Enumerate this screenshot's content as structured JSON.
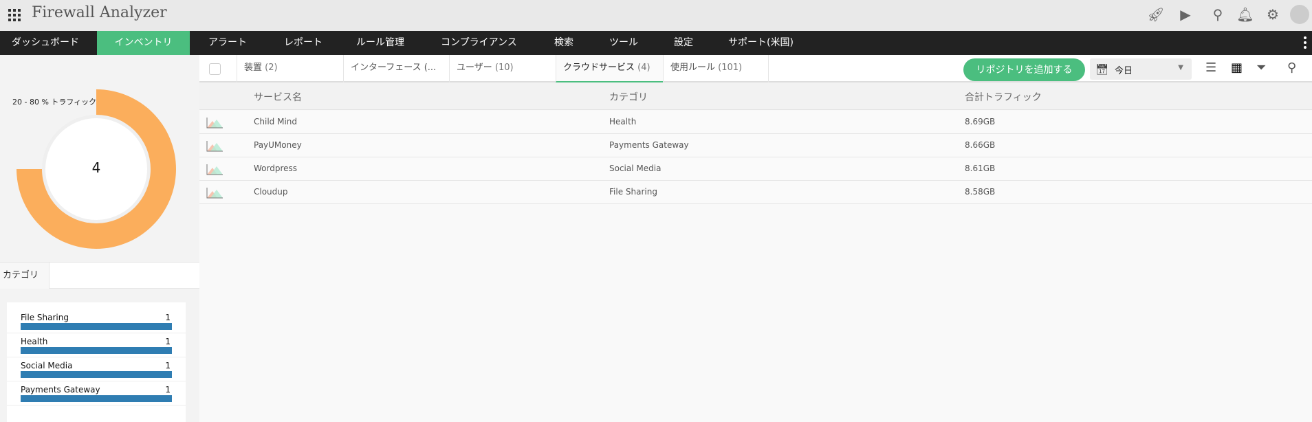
{
  "app": {
    "title": "Firewall Analyzer"
  },
  "top_icons": [
    "rocket-icon",
    "presentation-icon",
    "search-icon",
    "bell-icon",
    "gear-icon",
    "avatar-icon"
  ],
  "nav": {
    "items": [
      {
        "label": "ダッシュボード"
      },
      {
        "label": "インベントリ",
        "active": true
      },
      {
        "label": "アラート"
      },
      {
        "label": "レポート"
      },
      {
        "label": "ルール管理"
      },
      {
        "label": "コンプライアンス"
      },
      {
        "label": "検索"
      },
      {
        "label": "ツール"
      },
      {
        "label": "設定"
      },
      {
        "label": "サポート(米国)"
      }
    ]
  },
  "sidebar": {
    "donut": {
      "label": "20 - 80 % トラフィック",
      "value": "4",
      "fill_fraction": 0.75,
      "color": "#fbae5c"
    },
    "category_tab": "カテゴリ",
    "categories": [
      {
        "name": "File Sharing",
        "count": "1"
      },
      {
        "name": "Health",
        "count": "1"
      },
      {
        "name": "Social Media",
        "count": "1"
      },
      {
        "name": "Payments Gateway",
        "count": "1"
      }
    ]
  },
  "tabs": [
    {
      "label": "装置",
      "count": "(2)"
    },
    {
      "label": "インターフェース (...",
      "count": ""
    },
    {
      "label": "ユーザー",
      "count": "(10)"
    },
    {
      "label": "クラウドサービス",
      "count": "(4)",
      "active": true
    },
    {
      "label": "使用ルール",
      "count": "(101)"
    }
  ],
  "toolbar": {
    "add_repo": "リポジトリを追加する",
    "date": "今日"
  },
  "table": {
    "headers": [
      "サービス名",
      "カテゴリ",
      "合計トラフィック"
    ],
    "rows": [
      [
        "Child Mind",
        "Health",
        "8.69GB"
      ],
      [
        "PayUMoney",
        "Payments Gateway",
        "8.66GB"
      ],
      [
        "Wordpress",
        "Social Media",
        "8.61GB"
      ],
      [
        "Cloudup",
        "File Sharing",
        "8.58GB"
      ]
    ]
  },
  "colors": {
    "accent": "#4bbe7f",
    "bar": "#2f7db2",
    "nav": "#222222"
  }
}
